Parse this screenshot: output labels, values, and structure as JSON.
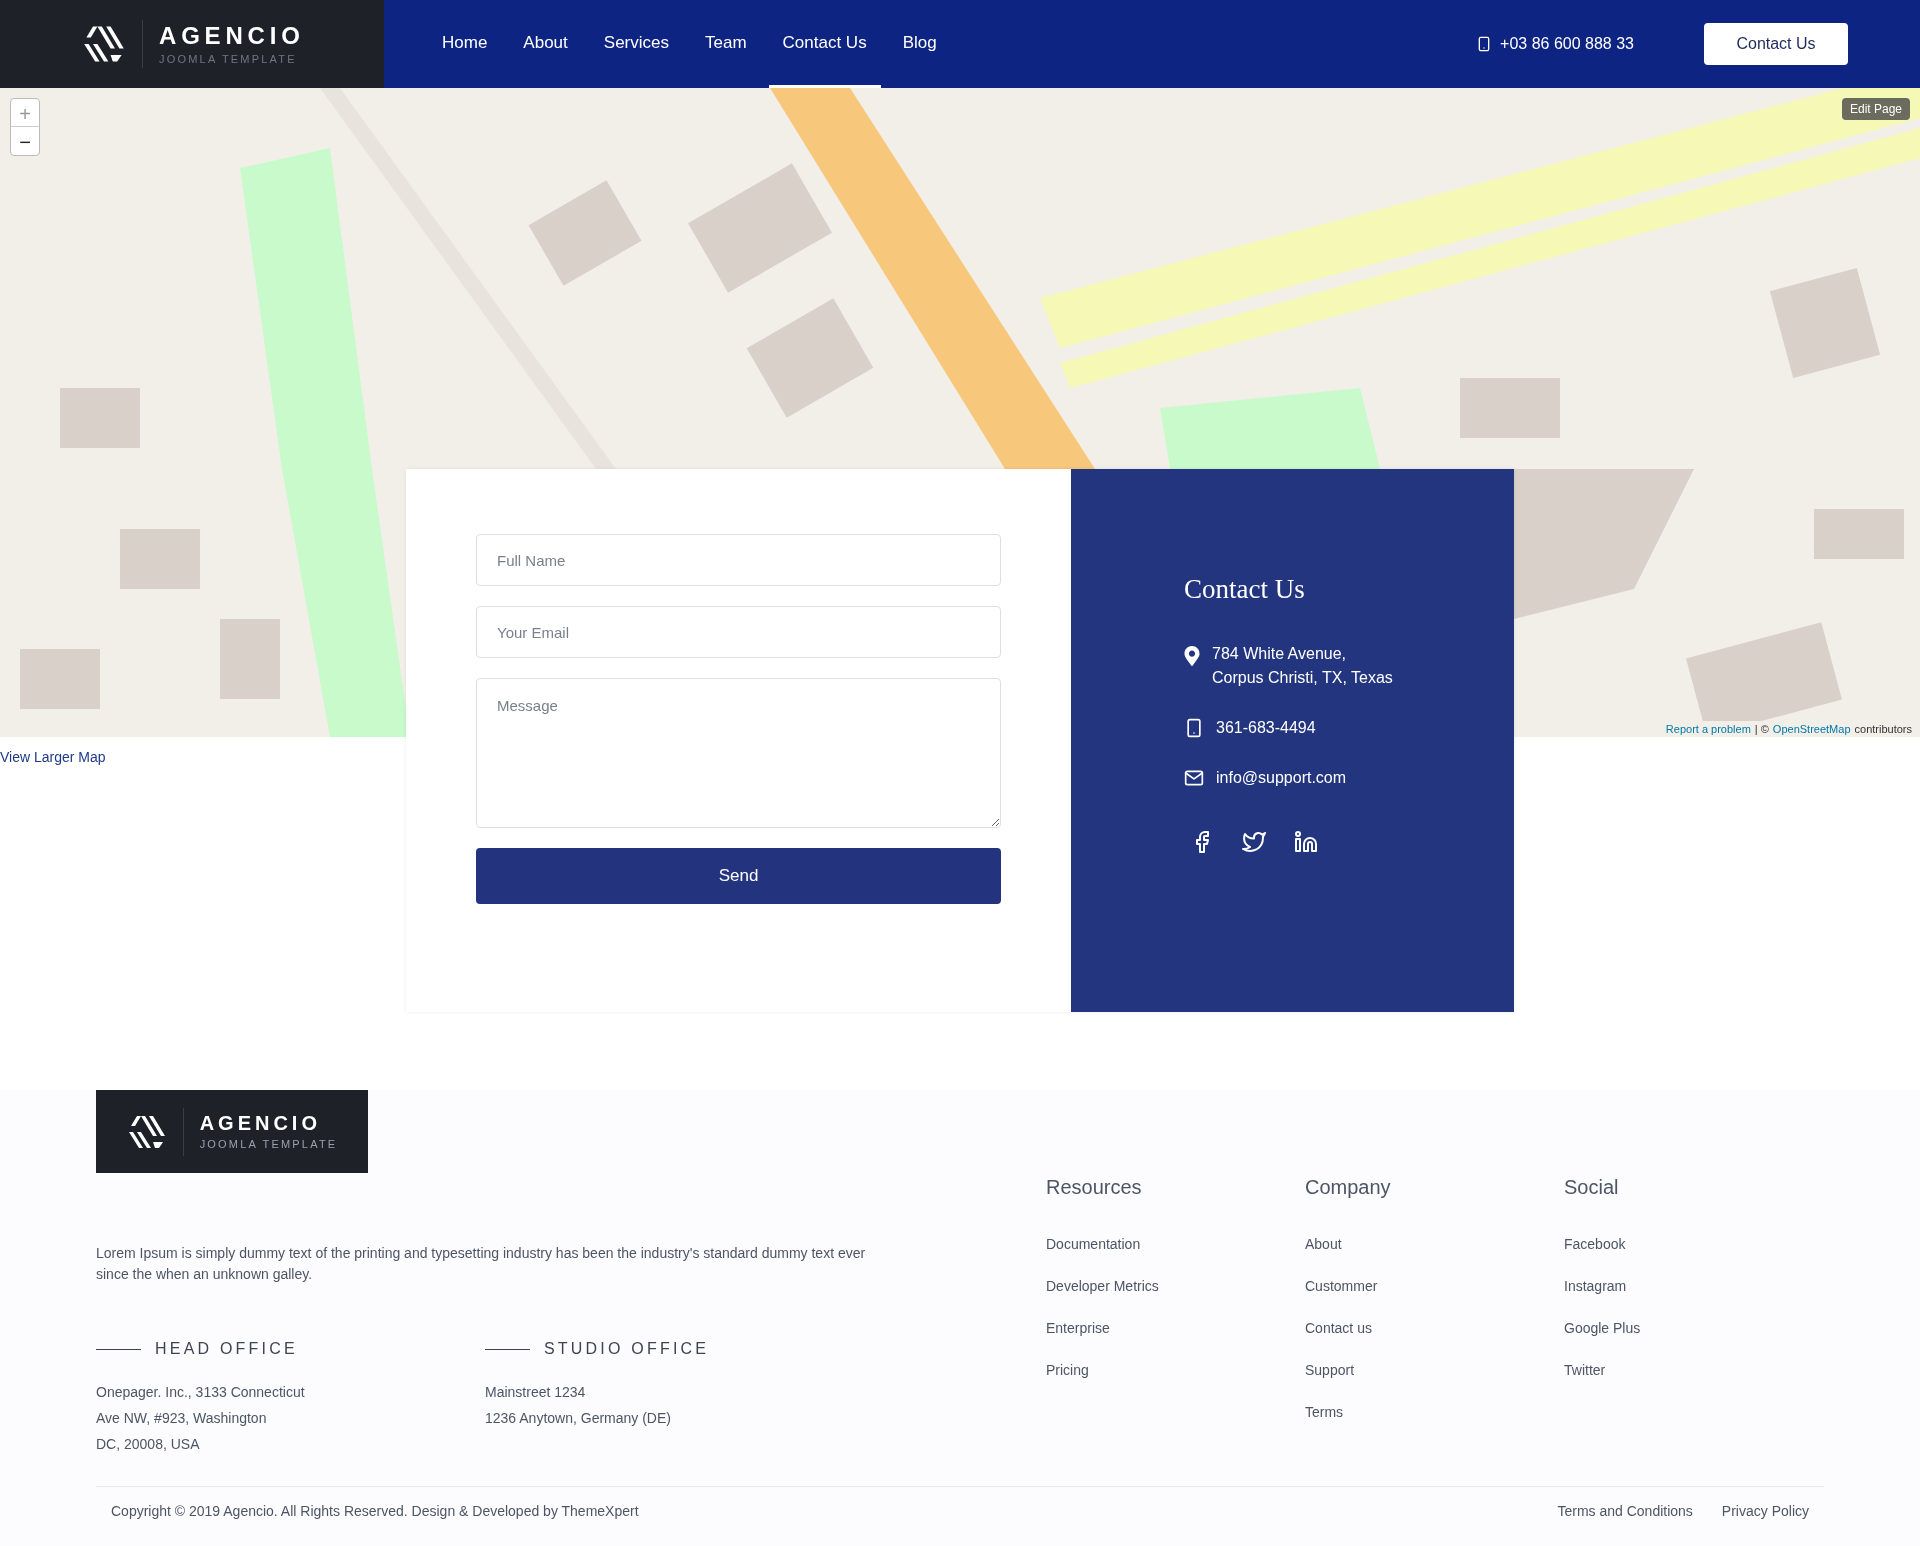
{
  "header": {
    "logo": {
      "name": "AGENCIO",
      "tagline": "JOOMLA TEMPLATE"
    },
    "nav": [
      {
        "label": "Home",
        "selected": false
      },
      {
        "label": "About",
        "selected": false
      },
      {
        "label": "Services",
        "selected": false
      },
      {
        "label": "Team",
        "selected": false
      },
      {
        "label": "Contact Us",
        "selected": true
      },
      {
        "label": "Blog",
        "selected": false
      }
    ],
    "phone": "+03 86 600 888 33",
    "cta": "Contact Us"
  },
  "map": {
    "zoom_in": "+",
    "zoom_out": "−",
    "edit": "Edit Page",
    "report": "Report a problem",
    "separator": "| ©",
    "osm": "OpenStreetMap",
    "suffix": "contributors",
    "larger_link": "View Larger Map"
  },
  "form": {
    "fields": [
      {
        "kind": "input",
        "placeholder": "Full Name"
      },
      {
        "kind": "input",
        "placeholder": "Your Email"
      },
      {
        "kind": "textarea",
        "placeholder": "Message"
      }
    ],
    "submit": "Send"
  },
  "contact": {
    "title": "Contact Us",
    "items": [
      {
        "kind": "address",
        "lines": [
          "784 White Avenue,",
          "Corpus Christi, TX, Texas"
        ]
      },
      {
        "kind": "phone",
        "lines": [
          "361-683-4494"
        ]
      },
      {
        "kind": "email",
        "lines": [
          "info@support.com"
        ]
      }
    ]
  },
  "footer": {
    "logo": {
      "name": "AGENCIO",
      "tagline": "JOOMLA TEMPLATE"
    },
    "description": "Lorem Ipsum is simply dummy text of the printing and typesetting industry has been the industry's standard dummy text ever since the when an unknown galley.",
    "offices": [
      {
        "title": "HEAD OFFICE",
        "lines": [
          "Onepager. Inc., 3133 Connecticut",
          "Ave NW, #923, Washington",
          "DC, 20008, USA"
        ]
      },
      {
        "title": "STUDIO OFFICE",
        "lines": [
          "Mainstreet 1234",
          "1236 Anytown, Germany (DE)"
        ]
      }
    ],
    "columns": [
      {
        "title": "Resources",
        "links": [
          "Documentation",
          "Developer Metrics",
          "Enterprise",
          "Pricing"
        ]
      },
      {
        "title": "Company",
        "links": [
          "About",
          "Custommer",
          "Contact us",
          "Support",
          "Terms"
        ]
      },
      {
        "title": "Social",
        "links": [
          "Facebook",
          "Instagram",
          "Google Plus",
          "Twitter"
        ]
      }
    ],
    "copyright": "Copyright © 2019 Agencio. All Rights Reserved. Design & Developed by ThemeXpert",
    "legal": [
      "Terms and Conditions",
      "Privacy Policy"
    ]
  }
}
